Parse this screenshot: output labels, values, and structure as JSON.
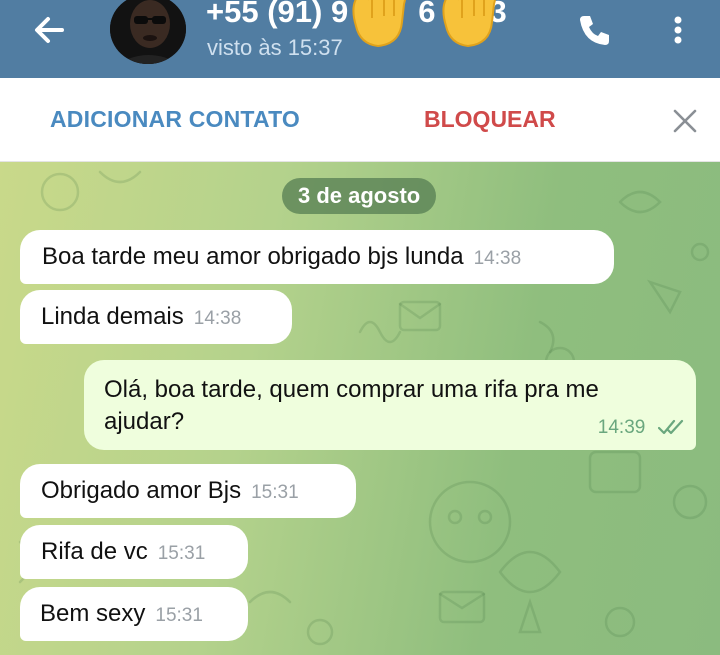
{
  "header": {
    "title": "+55 (91) 9",
    "title_tail": "6",
    "title_end": "3",
    "status": "visto às 15:37"
  },
  "actions": {
    "add_contact": "ADICIONAR CONTATO",
    "block": "BLOQUEAR"
  },
  "chat": {
    "date": "3 de agosto",
    "messages": [
      {
        "direction": "in",
        "text": "Boa tarde meu amor obrigado bjs lunda",
        "time": "14:38"
      },
      {
        "direction": "in",
        "text": "Linda demais",
        "time": "14:38"
      },
      {
        "direction": "out",
        "text": "Olá, boa tarde, quem comprar uma rifa pra me ajudar?",
        "time": "14:39",
        "read": true
      },
      {
        "direction": "in",
        "text": "Obrigado amor Bjs",
        "time": "15:31"
      },
      {
        "direction": "in",
        "text": "Rifa de vc",
        "time": "15:31"
      },
      {
        "direction": "in",
        "text": "Bem sexy",
        "time": "15:31"
      }
    ]
  },
  "colors": {
    "header_bg": "#517da2",
    "add_contact": "#4a8ac0",
    "block": "#d04a4a",
    "outgoing_bubble": "#effedd",
    "read_ticks": "#6aa77e"
  },
  "icons": [
    "back-arrow-icon",
    "phone-icon",
    "more-vertical-icon",
    "close-icon",
    "double-check-icon"
  ]
}
